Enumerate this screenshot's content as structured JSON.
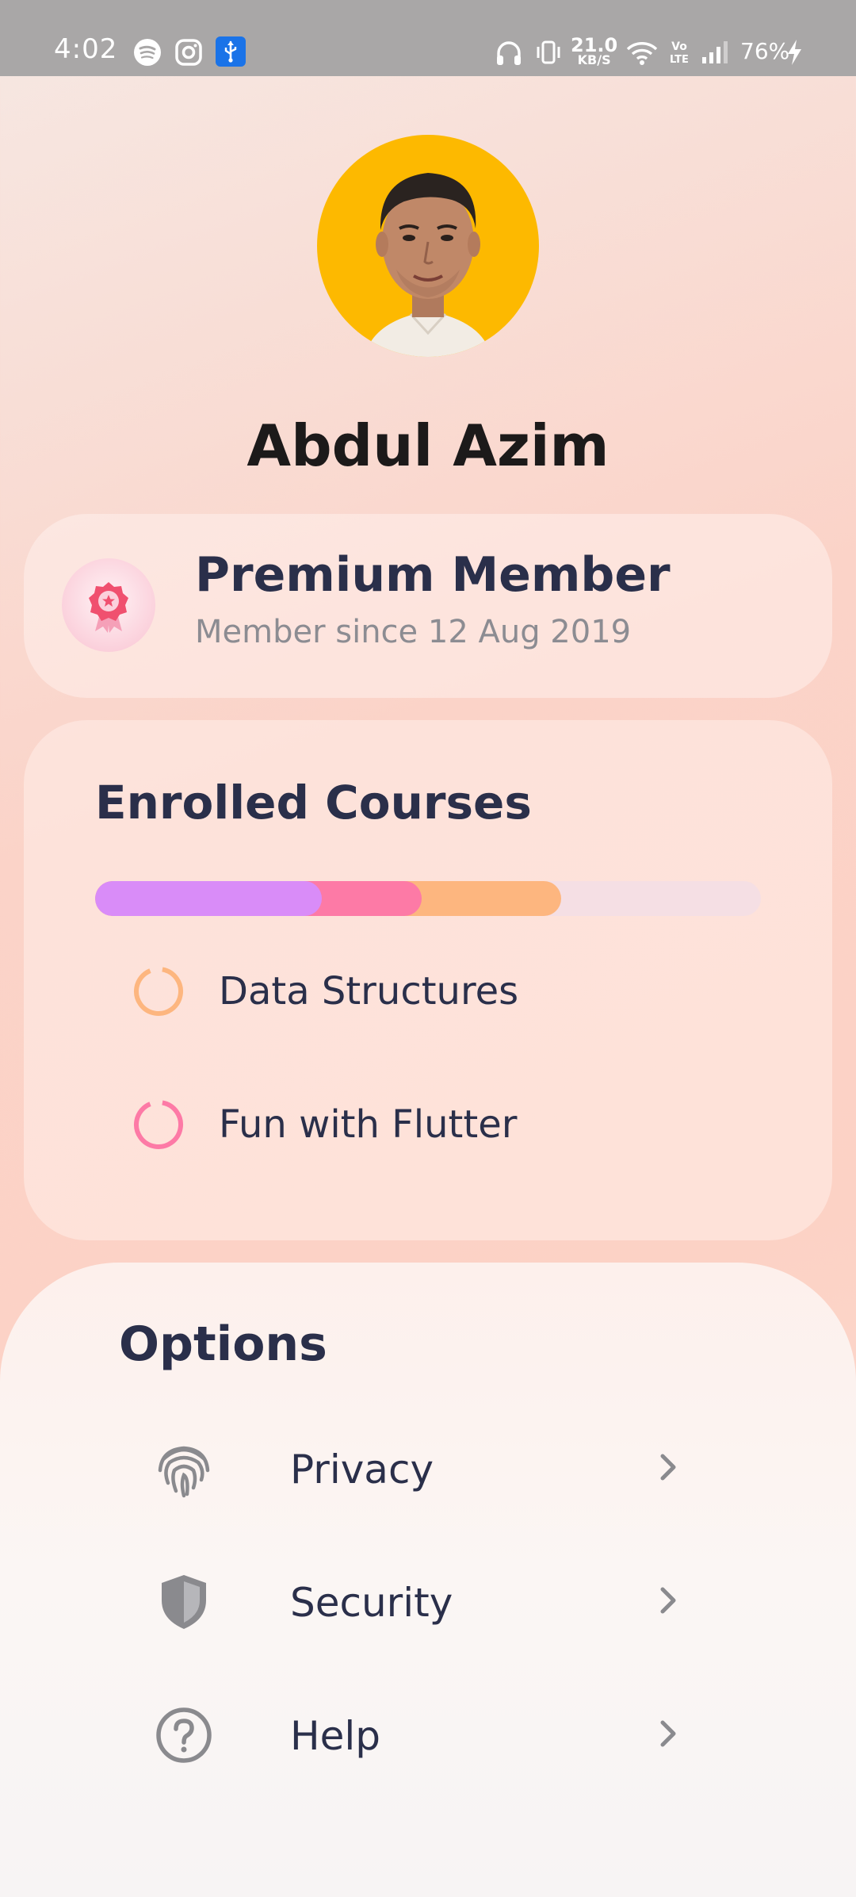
{
  "status_bar": {
    "time": "4:02",
    "net_speed_value": "21.0",
    "net_speed_unit": "KB/S",
    "battery": "76%",
    "icons": [
      "spotify-icon",
      "instagram-icon",
      "usb-icon",
      "headphones-icon",
      "vibrate-icon",
      "wifi-icon",
      "volte-icon",
      "signal-icon",
      "charging-icon"
    ],
    "volte_label": "Vo LTE"
  },
  "profile": {
    "name": "Abdul Azim",
    "avatar_bg": "#fdb900"
  },
  "membership": {
    "title": "Premium Member",
    "subtitle": "Member since 12 Aug 2019",
    "icon": "award-badge-icon"
  },
  "courses": {
    "title": "Enrolled Courses",
    "progress": {
      "segments": [
        {
          "color": "#d98cf8",
          "fraction": 0.34
        },
        {
          "color": "#fd7aa6",
          "fraction": 0.15
        },
        {
          "color": "#fdb67f",
          "fraction": 0.21
        }
      ],
      "track_color": "#f5dfe4"
    },
    "items": [
      {
        "label": "Data Structures",
        "ring_color": "#fdb67f"
      },
      {
        "label": "Fun with Flutter",
        "ring_color": "#fd7aa6"
      }
    ]
  },
  "options": {
    "title": "Options",
    "items": [
      {
        "label": "Privacy",
        "icon": "fingerprint-icon"
      },
      {
        "label": "Security",
        "icon": "shield-icon"
      },
      {
        "label": "Help",
        "icon": "help-circle-icon"
      }
    ]
  }
}
